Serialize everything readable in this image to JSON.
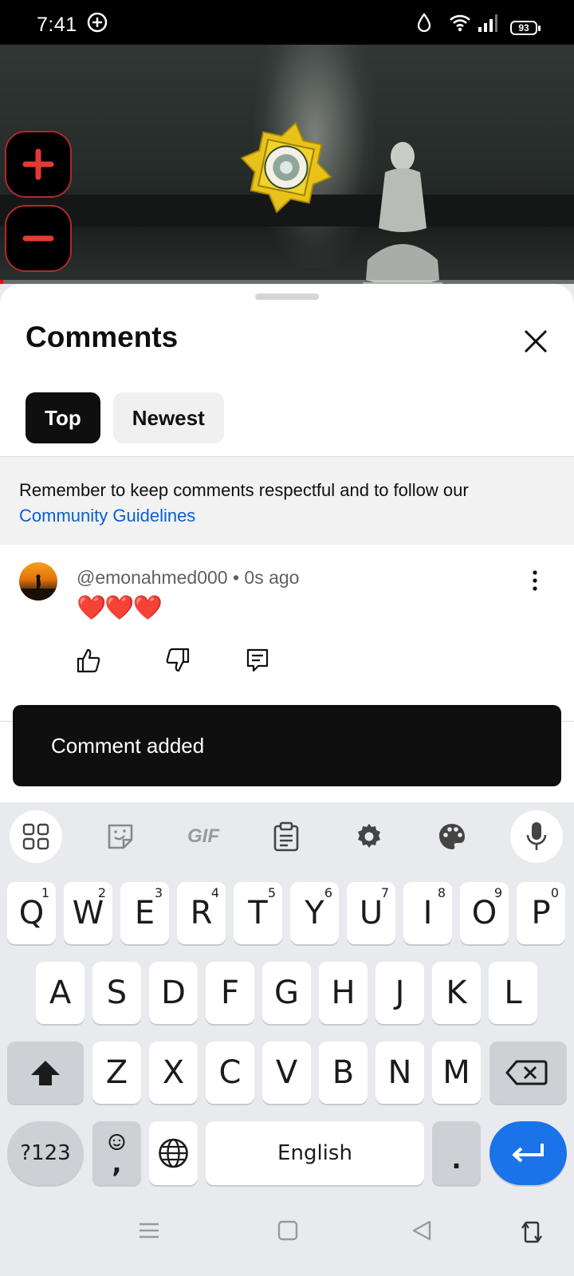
{
  "status_bar": {
    "time": "7:41",
    "battery": "93",
    "icons": [
      "add-circle-icon",
      "water-drop-icon",
      "wifi-icon",
      "signal-icon",
      "battery-icon"
    ]
  },
  "video": {
    "progress_fraction": 0.0,
    "accent": "#ff0000"
  },
  "sheet": {
    "title": "Comments",
    "chips": [
      "Top",
      "Newest"
    ],
    "active_chip": "Top",
    "notice_text": "Remember to keep comments respectful and to follow our",
    "notice_link": "Community Guidelines",
    "link_color": "#065fd4"
  },
  "comment": {
    "author_meta": "@emonahmed000 • 0s ago",
    "text": "❤️❤️❤️"
  },
  "snackbar": {
    "text": "Comment added"
  },
  "keyboard": {
    "toolbar_icons": [
      "apps-grid-icon",
      "sticker-icon",
      "gif-icon",
      "clipboard-icon",
      "settings-gear-icon",
      "palette-icon",
      "microphone-icon"
    ],
    "gif_label": "GIF",
    "row1": [
      {
        "key": "Q",
        "hint": "1"
      },
      {
        "key": "W",
        "hint": "2"
      },
      {
        "key": "E",
        "hint": "3"
      },
      {
        "key": "R",
        "hint": "4"
      },
      {
        "key": "T",
        "hint": "5"
      },
      {
        "key": "Y",
        "hint": "6"
      },
      {
        "key": "U",
        "hint": "7"
      },
      {
        "key": "I",
        "hint": "8"
      },
      {
        "key": "O",
        "hint": "9"
      },
      {
        "key": "P",
        "hint": "0"
      }
    ],
    "row2": [
      "A",
      "S",
      "D",
      "F",
      "G",
      "H",
      "J",
      "K",
      "L"
    ],
    "row3": [
      "Z",
      "X",
      "C",
      "V",
      "B",
      "N",
      "M"
    ],
    "symbols_label": "?123",
    "comma_label": ",",
    "space_label": "English",
    "period_label": "."
  }
}
